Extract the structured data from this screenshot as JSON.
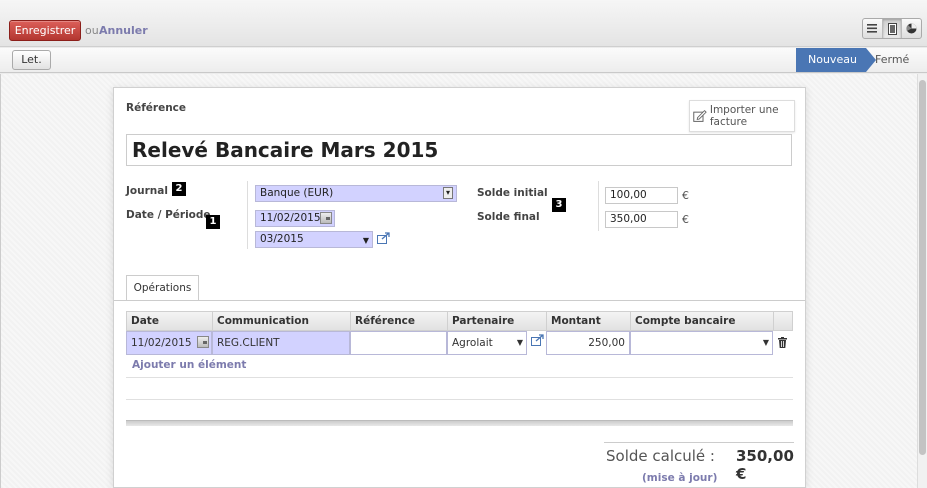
{
  "toolbar": {
    "save_label": "Enregistrer",
    "or_label": "ou",
    "cancel_label": "Annuler"
  },
  "view_switcher": [
    "list-icon",
    "form-icon",
    "graph-icon"
  ],
  "statusbar": {
    "let_label": "Let.",
    "stages": [
      "Nouveau",
      "Fermé"
    ],
    "active_stage": "Nouveau"
  },
  "form": {
    "reference_label": "Référence",
    "import_label": "Importer une facture",
    "title": "Relevé Bancaire Mars 2015",
    "journal_label": "Journal",
    "date_period_label": "Date / Période",
    "journal_value": "Banque (EUR)",
    "date_value": "11/02/2015",
    "period_value": "03/2015",
    "balance_start_label": "Solde initial",
    "balance_end_label": "Solde final",
    "balance_start_value": "100,00",
    "balance_end_value": "350,00",
    "currency_symbol": "€",
    "badges": [
      "1",
      "2",
      "3"
    ]
  },
  "tabs": [
    "Opérations"
  ],
  "grid": {
    "headers": [
      "Date",
      "Communication",
      "Référence",
      "Partenaire",
      "Montant",
      "Compte bancaire"
    ],
    "row": {
      "date": "11/02/2015",
      "communication": "REG.CLIENT",
      "reference": "",
      "partner": "Agrolait",
      "amount": "250,00",
      "bank_account": ""
    },
    "add_label": "Ajouter un élément"
  },
  "totals": {
    "computed_label": "Solde calculé :",
    "computed_value": "350,00 €",
    "update_label": "(mise à jour)"
  },
  "colors": {
    "save_red": "#c9433d",
    "stage_blue": "#4a76b4",
    "link_purple": "#7c7bad",
    "editable_field": "#d2d2ff"
  }
}
